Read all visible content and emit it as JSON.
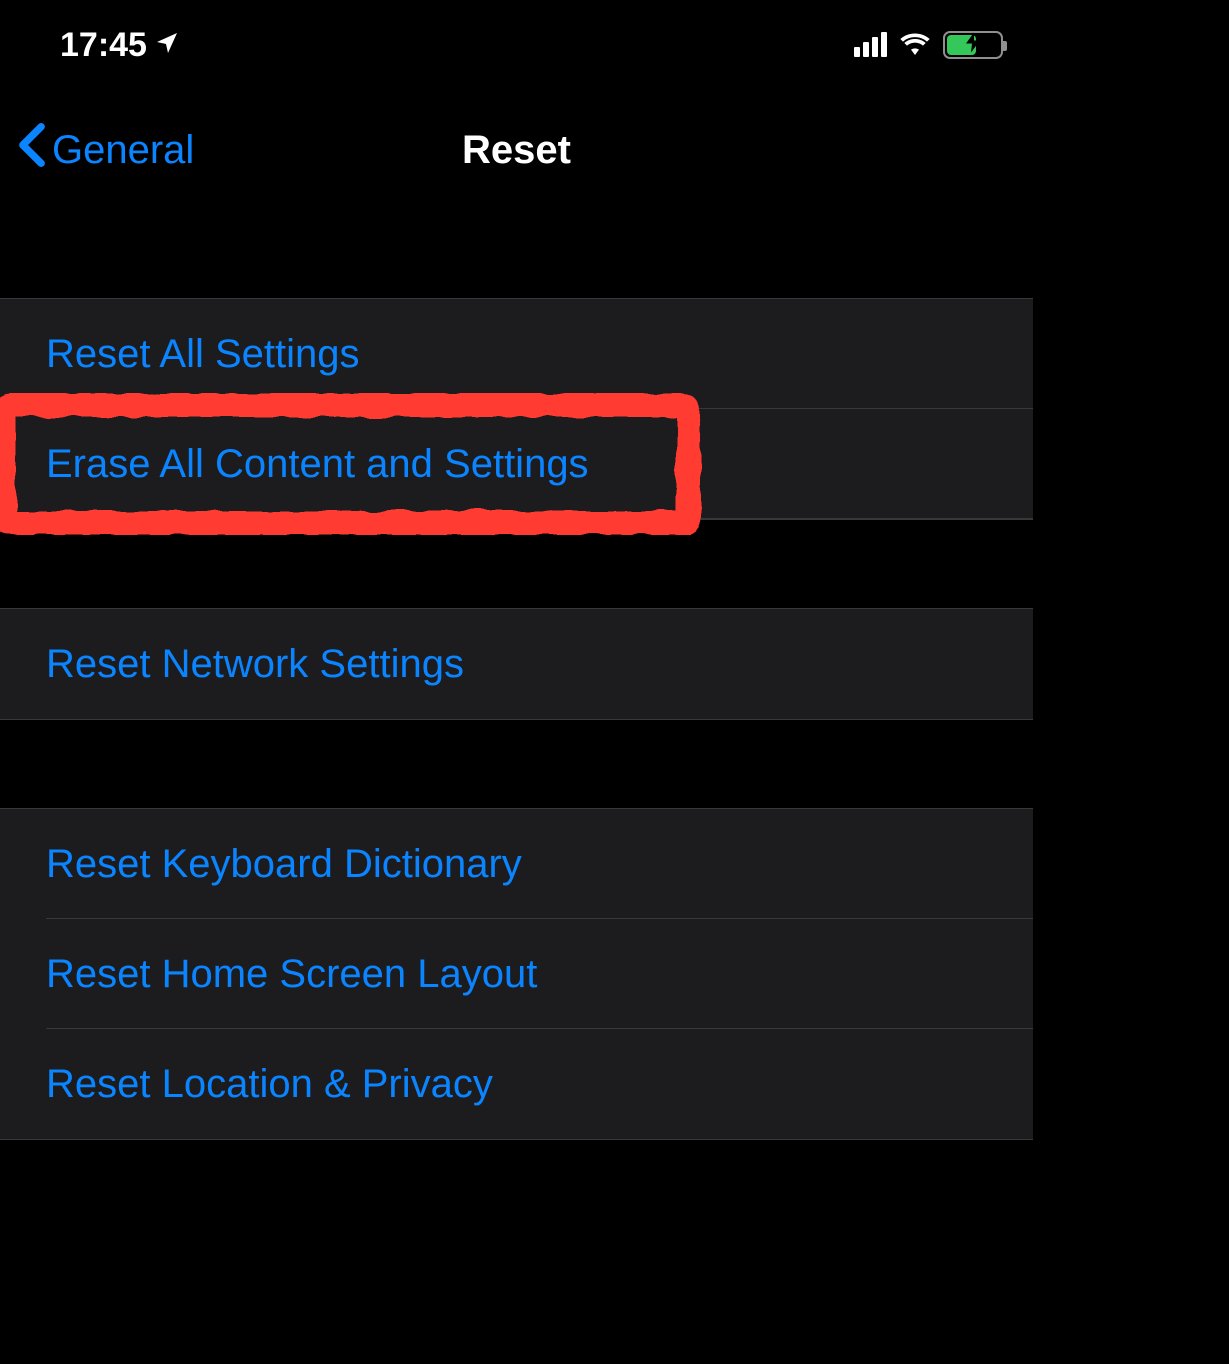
{
  "status": {
    "time": "17:45"
  },
  "nav": {
    "back_label": "General",
    "title": "Reset"
  },
  "groups": [
    {
      "items": [
        {
          "id": "reset-all-settings",
          "label": "Reset All Settings"
        },
        {
          "id": "erase-all-content",
          "label": "Erase All Content and Settings",
          "highlighted": true
        }
      ]
    },
    {
      "items": [
        {
          "id": "reset-network",
          "label": "Reset Network Settings"
        }
      ]
    },
    {
      "items": [
        {
          "id": "reset-keyboard",
          "label": "Reset Keyboard Dictionary"
        },
        {
          "id": "reset-home-screen",
          "label": "Reset Home Screen Layout"
        },
        {
          "id": "reset-location-privacy",
          "label": "Reset Location & Privacy"
        }
      ]
    }
  ],
  "colors": {
    "link": "#0a84ff",
    "highlight": "#ff3b30",
    "battery_fill": "#34c759"
  }
}
